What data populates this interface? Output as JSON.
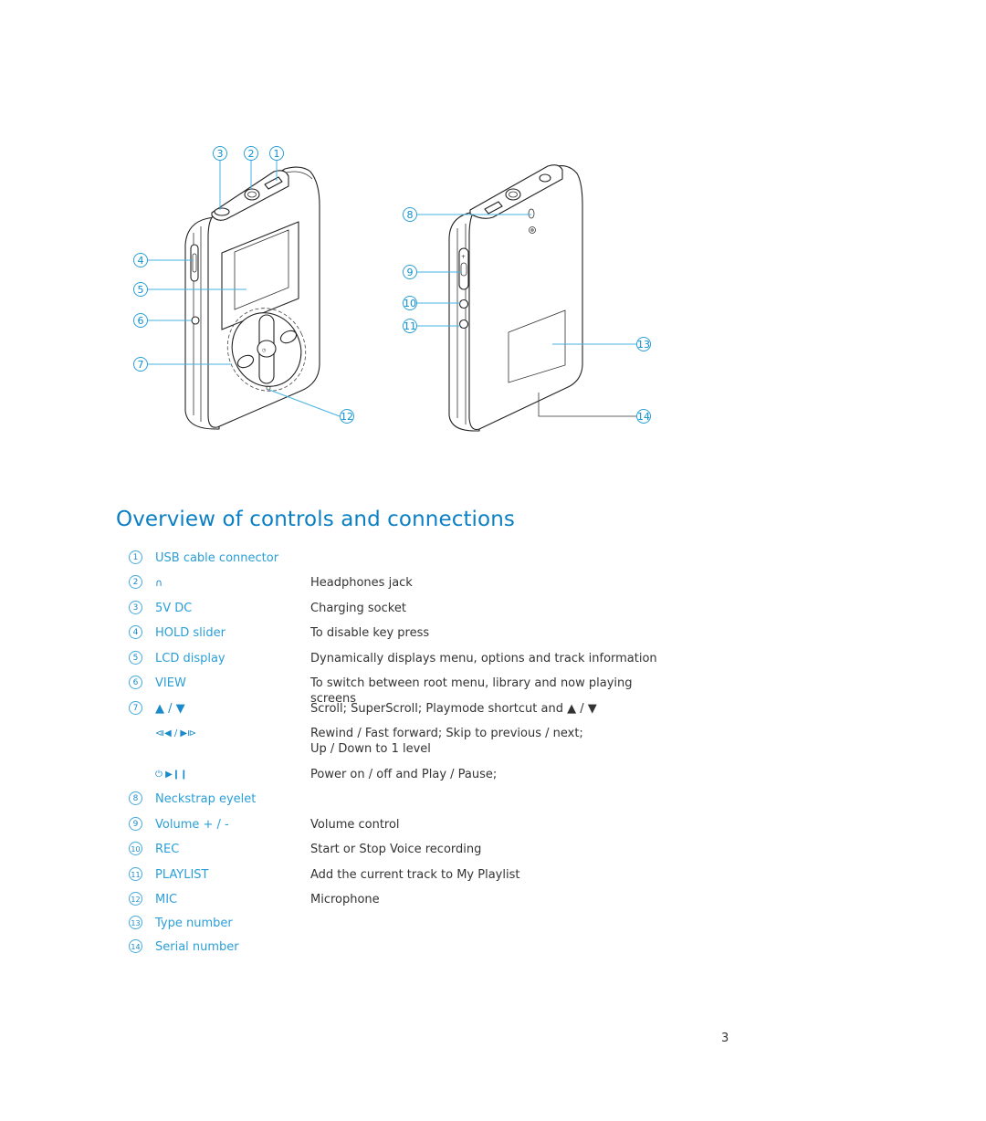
{
  "page": {
    "title": "Overview of controls and connections",
    "page_number": "3"
  },
  "colors": {
    "accent": "#0a7fc4",
    "label": "#2a9fd8",
    "leader": "#46b3e3",
    "body_text": "#333333"
  },
  "figure": {
    "front_callouts": [
      "3",
      "2",
      "1",
      "4",
      "5",
      "6",
      "7",
      "12"
    ],
    "back_callouts": [
      "8",
      "9",
      "10",
      "11",
      "13",
      "14"
    ]
  },
  "items": [
    {
      "num": "1",
      "label": "USB cable connector",
      "desc": ""
    },
    {
      "num": "2",
      "label": "",
      "icon": "headphones-icon",
      "glyph": "∩",
      "desc": "Headphones jack"
    },
    {
      "num": "3",
      "label": "5V DC",
      "desc": "Charging socket"
    },
    {
      "num": "4",
      "label": "HOLD slider",
      "desc": "To disable key press"
    },
    {
      "num": "5",
      "label": "LCD display",
      "desc": "Dynamically displays menu, options and track information"
    },
    {
      "num": "6",
      "label": "VIEW",
      "desc": "To switch between root menu, library and now playing screens"
    },
    {
      "num": "7",
      "label": "▲ / ▼",
      "icon": "up-down-arrows-icon",
      "desc": "Scroll; SuperScroll; Playmode shortcut and ▲ / ▼"
    },
    {
      "num": "",
      "label": "⧏◀ / ▶⧐",
      "icon": "skip-previous-next-icon",
      "desc": "Rewind / Fast forward; Skip to previous / next; Up / Down to 1 level"
    },
    {
      "num": "",
      "label": "⏻  ▶❙❙",
      "icon": "power-play-pause-icon",
      "desc": "Power on / off and Play / Pause;"
    },
    {
      "num": "8",
      "label": "Neckstrap eyelet",
      "desc": ""
    },
    {
      "num": "9",
      "label": "Volume + / -",
      "desc": "Volume control"
    },
    {
      "num": "10",
      "label": "REC",
      "desc": "Start or Stop Voice recording"
    },
    {
      "num": "11",
      "label": "PLAYLIST",
      "desc": "Add the current track to My Playlist"
    },
    {
      "num": "12",
      "label": "MIC",
      "desc": "Microphone"
    },
    {
      "num": "13",
      "label": "Type number",
      "desc": ""
    },
    {
      "num": "14",
      "label": "Serial number",
      "desc": ""
    }
  ]
}
